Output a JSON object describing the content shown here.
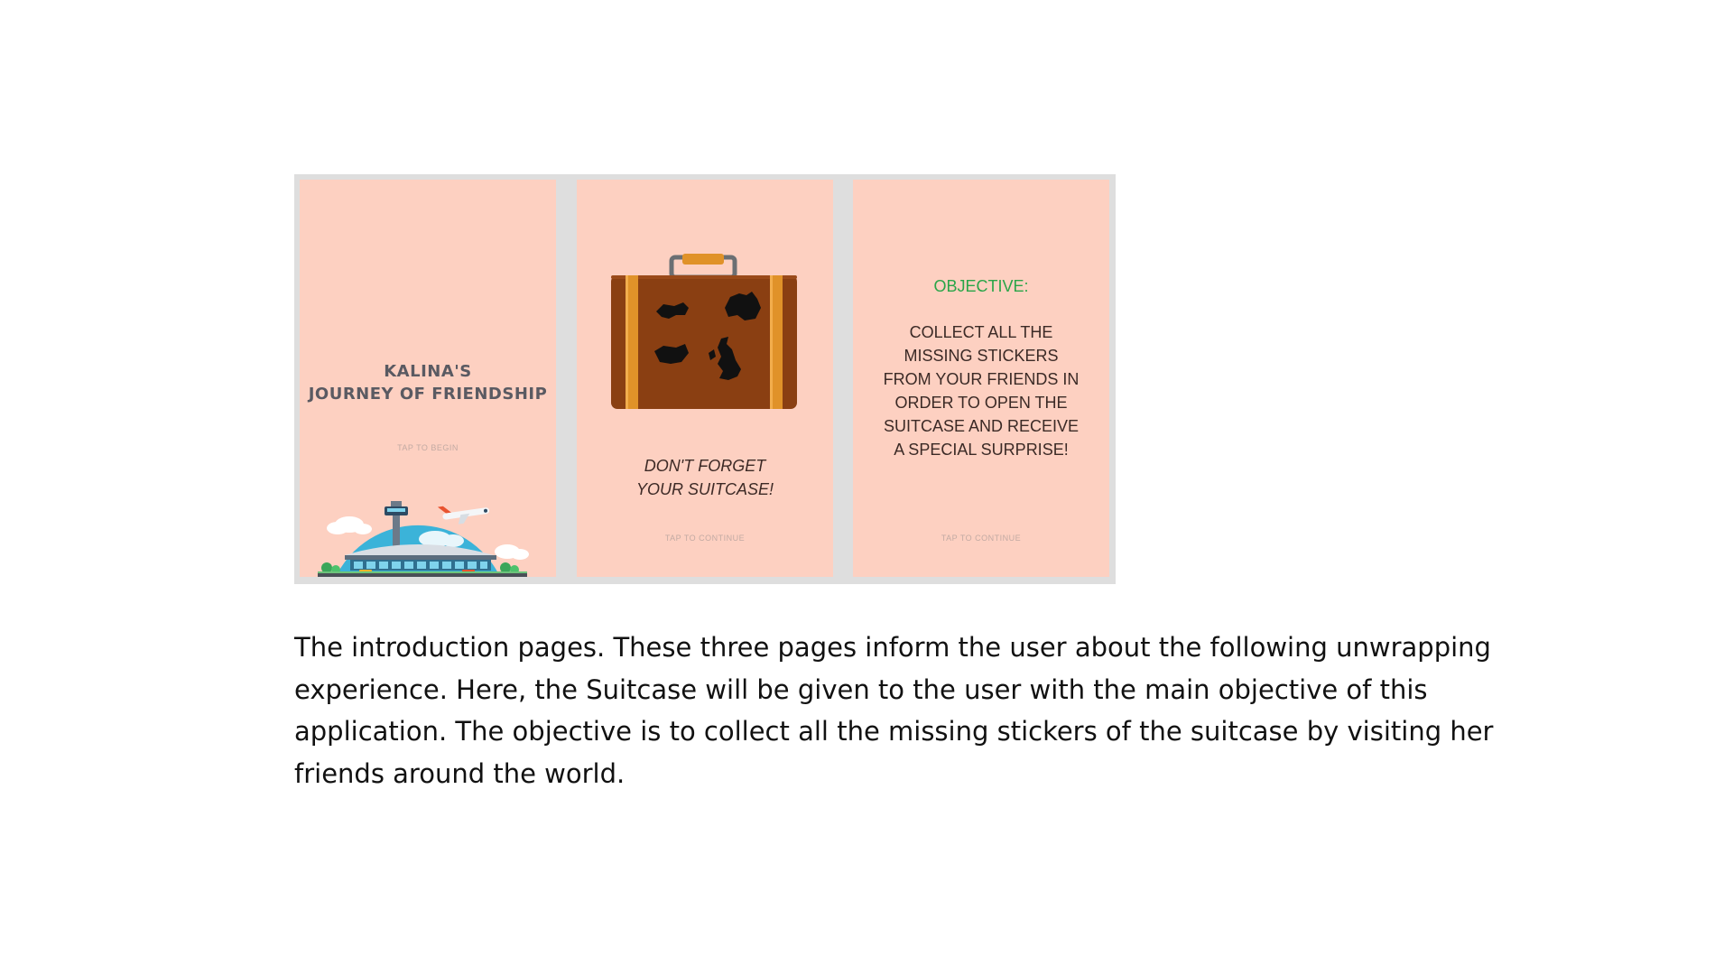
{
  "screens": [
    {
      "title_line1": "KALINA'S",
      "title_line2": "JOURNEY OF FRIENDSHIP",
      "hint": "TAP TO BEGIN"
    },
    {
      "slogan_line1": "DON'T FORGET",
      "slogan_line2": "YOUR SUITCASE!",
      "hint": "TAP TO CONTINUE"
    },
    {
      "heading": "OBJECTIVE:",
      "body": "COLLECT ALL THE MISSING STICKERS FROM YOUR FRIENDS IN ORDER TO OPEN THE SUITCASE AND RECEIVE A SPECIAL SURPRISE!",
      "hint": "TAP TO CONTINUE"
    }
  ],
  "caption": "The introduction pages. These three pages inform the user about the following unwrapping experience. Here, the Suitcase will be given to the user with the main objective of this application. The objective is to collect all the missing stickers of the suitcase by visiting her friends around the world.",
  "colors": {
    "screen_bg": "#fdd0c1",
    "frame_bg": "#dedede",
    "objective_green": "#2aa548",
    "suitcase_brown": "#8a3f12",
    "strap_orange": "#e09229"
  }
}
